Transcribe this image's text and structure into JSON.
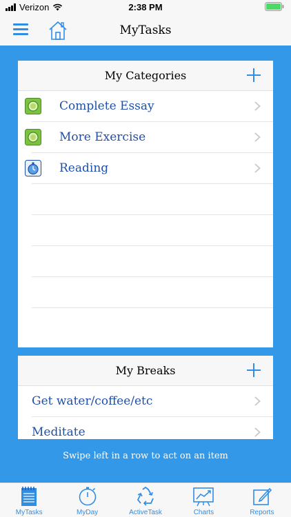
{
  "status": {
    "carrier": "Verizon",
    "time": "2:38 PM"
  },
  "navbar": {
    "title": "MyTasks",
    "menu_icon": "hamburger-menu-icon",
    "home_icon": "home-icon"
  },
  "categories": {
    "title": "My Categories",
    "items": [
      {
        "label": "Complete Essay",
        "icon": "green-circle-icon"
      },
      {
        "label": "More Exercise",
        "icon": "green-circle-icon"
      },
      {
        "label": "Reading",
        "icon": "stopwatch-icon"
      }
    ]
  },
  "breaks": {
    "title": "My Breaks",
    "items": [
      {
        "label": "Get water/coffee/etc"
      },
      {
        "label": "Meditate"
      }
    ]
  },
  "hint": "Swipe left in a row to act on an item",
  "tabs": [
    {
      "label": "MyTasks",
      "icon": "notepad-icon"
    },
    {
      "label": "MyDay",
      "icon": "stopwatch-icon"
    },
    {
      "label": "ActiveTask",
      "icon": "recycle-icon"
    },
    {
      "label": "Charts",
      "icon": "chart-icon"
    },
    {
      "label": "Reports",
      "icon": "edit-report-icon"
    }
  ],
  "colors": {
    "accent": "#2f8de4",
    "background_blue": "#3498e8",
    "label_blue": "#1f4fa8",
    "category_green": "#7cc242"
  }
}
